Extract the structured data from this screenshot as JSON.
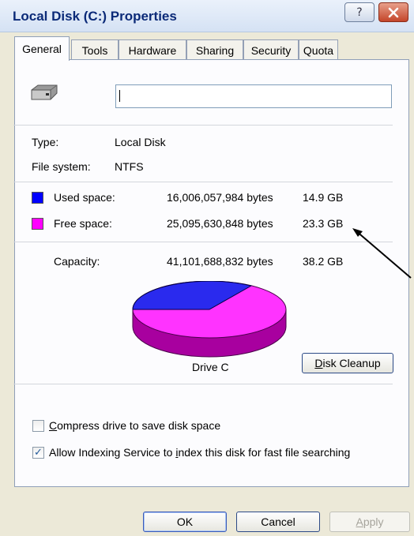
{
  "window": {
    "title": "Local Disk (C:) Properties",
    "help_glyph": "?",
    "close_glyph": "✕"
  },
  "tabs": [
    {
      "label": "General"
    },
    {
      "label": "Tools"
    },
    {
      "label": "Hardware"
    },
    {
      "label": "Sharing"
    },
    {
      "label": "Security"
    },
    {
      "label": "Quota"
    }
  ],
  "general": {
    "volume_label_value": "",
    "type_label": "Type:",
    "type_value": "Local Disk",
    "fs_label": "File system:",
    "fs_value": "NTFS",
    "used": {
      "label": "Used space:",
      "bytes": "16,006,057,984 bytes",
      "size": "14.9 GB",
      "color": "#0000ff"
    },
    "free": {
      "label": "Free space:",
      "bytes": "25,095,630,848 bytes",
      "size": "23.3 GB",
      "color": "#ff00ff"
    },
    "capacity": {
      "label": "Capacity:",
      "bytes": "41,101,688,832 bytes",
      "size": "38.2 GB"
    },
    "drive_label": "Drive C",
    "cleanup": {
      "mnemonic": "D",
      "rest": "isk Cleanup"
    },
    "compress": {
      "mnemonic": "C",
      "rest": "ompress drive to save disk space",
      "checked": false
    },
    "indexing": {
      "before": "Allow Indexing Service to ",
      "mnemonic": "i",
      "after": "ndex this disk for fast file searching",
      "checked": true,
      "check_glyph": "✓"
    }
  },
  "buttons": {
    "ok": "OK",
    "cancel": "Cancel",
    "apply": {
      "mnemonic": "A",
      "rest": "pply",
      "disabled": true
    }
  },
  "colors": {
    "used_pie_top": "#2a2aee",
    "used_pie_side": "#0000a0",
    "free_pie_top": "#ff33ff",
    "free_pie_side": "#a8009f",
    "title_text": "#0b2a78"
  }
}
